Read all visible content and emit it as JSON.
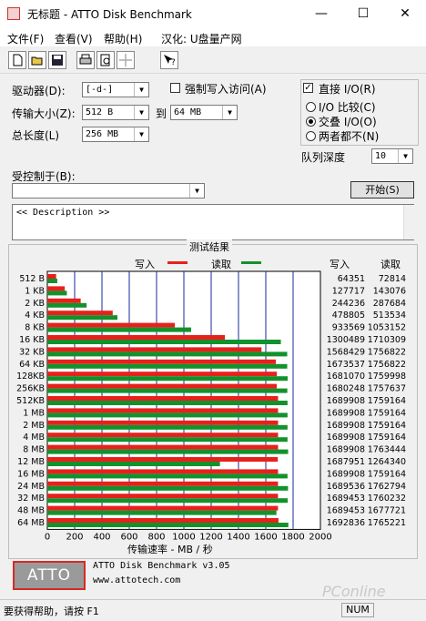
{
  "window": {
    "title": "无标题 - ATTO Disk Benchmark",
    "minimize_glyph": "—",
    "maximize_glyph": "☐",
    "close_glyph": "✕"
  },
  "menu": [
    "文件(F)",
    "查看(V)",
    "帮助(H)",
    "汉化: U盘量产网"
  ],
  "toolbar_icons": [
    "new-icon",
    "open-icon",
    "save-icon",
    "print-icon",
    "print-preview-icon",
    "move-icon",
    "help-icon"
  ],
  "settings": {
    "drive_label": "驱动器(D):",
    "drive_value": "[-d-]",
    "force_write_label": "强制写入访问(A)",
    "transfer_label": "传输大小(Z):",
    "transfer_from": "512 B",
    "to_label": "到",
    "transfer_to": "64 MB",
    "total_length_label": "总长度(L)",
    "total_length_value": "256 MB",
    "direct_io_label": "直接 I/O(R)",
    "io_compare_label": "I/O 比较(C)",
    "overlap_io_label": "交叠 I/O(O)",
    "neither_label": "两者都不(N)",
    "queue_depth_label": "队列深度",
    "queue_depth_value": "10",
    "controlled_by_label": "受控制于(B):",
    "controlled_by_value": "",
    "start_button": "开始(S)",
    "description": "<< Description >>"
  },
  "results": {
    "title": "测试结果",
    "write_legend": "写入",
    "read_legend": "读取",
    "col_write": "写入",
    "col_read": "读取",
    "xlabel": "传输速率 - MB / 秒",
    "write_color": "#e8201c",
    "read_color": "#12922c"
  },
  "chart_data": {
    "type": "bar",
    "orientation": "horizontal",
    "categories": [
      "512 B",
      "1 KB",
      "2 KB",
      "4 KB",
      "8 KB",
      "16 KB",
      "32 KB",
      "64 KB",
      "128KB",
      "256KB",
      "512KB",
      "1 MB",
      "2 MB",
      "4 MB",
      "8 MB",
      "12 MB",
      "16 MB",
      "24 MB",
      "32 MB",
      "48 MB",
      "64 MB"
    ],
    "series": [
      {
        "name": "写入",
        "values": [
          64351,
          127717,
          244236,
          478805,
          933569,
          1300489,
          1568429,
          1673537,
          1681070,
          1680248,
          1689908,
          1689908,
          1689908,
          1689908,
          1689908,
          1687951,
          1689908,
          1689536,
          1689453,
          1689453,
          1692836
        ]
      },
      {
        "name": "读取",
        "values": [
          72814,
          143076,
          287684,
          513534,
          1053152,
          1710309,
          1756822,
          1756822,
          1759998,
          1757637,
          1759164,
          1759164,
          1759164,
          1759164,
          1763444,
          1264340,
          1759164,
          1762794,
          1760232,
          1677721,
          1765221
        ]
      }
    ],
    "xlim": [
      0,
      2000
    ],
    "x_ticks": [
      "0",
      "200",
      "400",
      "600",
      "800",
      "1000",
      "1200",
      "1400",
      "1600",
      "1800",
      "2000"
    ],
    "xlabel": "传输速率 - MB / 秒",
    "grid": true
  },
  "about": {
    "logo": "ATTO",
    "product": "ATTO Disk Benchmark v3.05",
    "url": "www.attotech.com"
  },
  "status": {
    "text": "要获得帮助，请按 F1",
    "num": "NUM"
  },
  "watermark": "PConline"
}
